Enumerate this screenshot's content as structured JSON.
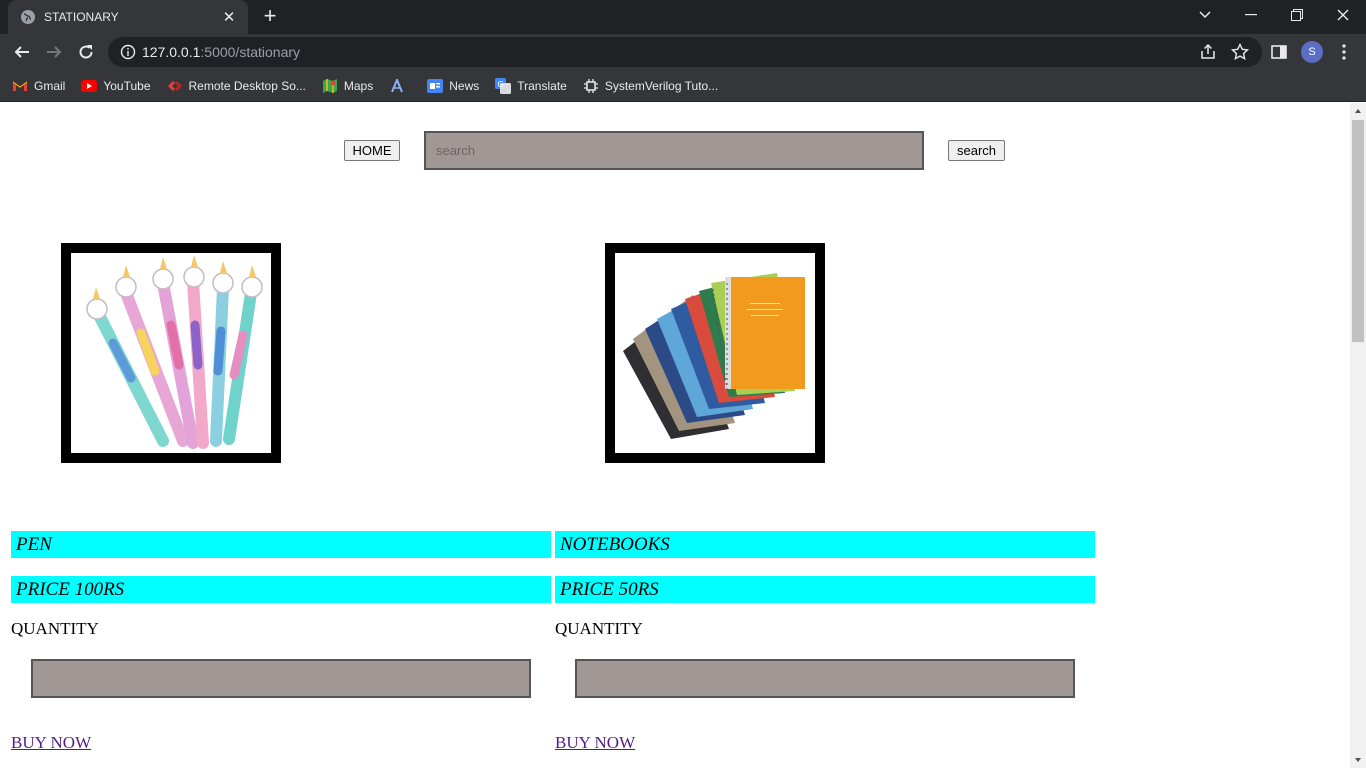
{
  "browser": {
    "tab_title": "STATIONARY",
    "url_host": "127.0.0.1",
    "url_rest": ":5000/stationary",
    "profile_initial": "S",
    "bookmarks": [
      {
        "label": "Gmail",
        "icon": "gmail-icon"
      },
      {
        "label": "YouTube",
        "icon": "youtube-icon"
      },
      {
        "label": "Remote Desktop So...",
        "icon": "remote-desktop-icon"
      },
      {
        "label": "Maps",
        "icon": "maps-icon"
      },
      {
        "label": "",
        "icon": "bookmark-a-icon"
      },
      {
        "label": "News",
        "icon": "news-icon"
      },
      {
        "label": "Translate",
        "icon": "translate-icon"
      },
      {
        "label": "SystemVerilog Tuto...",
        "icon": "chip-icon"
      }
    ]
  },
  "page": {
    "home_label": "HOME",
    "search_placeholder": "search",
    "search_label": "search",
    "products": [
      {
        "name": "PEN",
        "price": "PRICE 100RS",
        "quantity_label": "QUANTITY",
        "buy_label": "BUY NOW",
        "image": "unicorn-pens"
      },
      {
        "name": "NOTEBOOKS",
        "price": "PRICE 50RS",
        "quantity_label": "QUANTITY",
        "buy_label": "BUY NOW",
        "image": "spiral-notebooks"
      }
    ]
  },
  "colors": {
    "chrome_dark": "#202124",
    "chrome_toolbar": "#35363a",
    "input_bg": "#a19896",
    "label_bar": "#00ffff",
    "visited_link": "#551a8b"
  }
}
